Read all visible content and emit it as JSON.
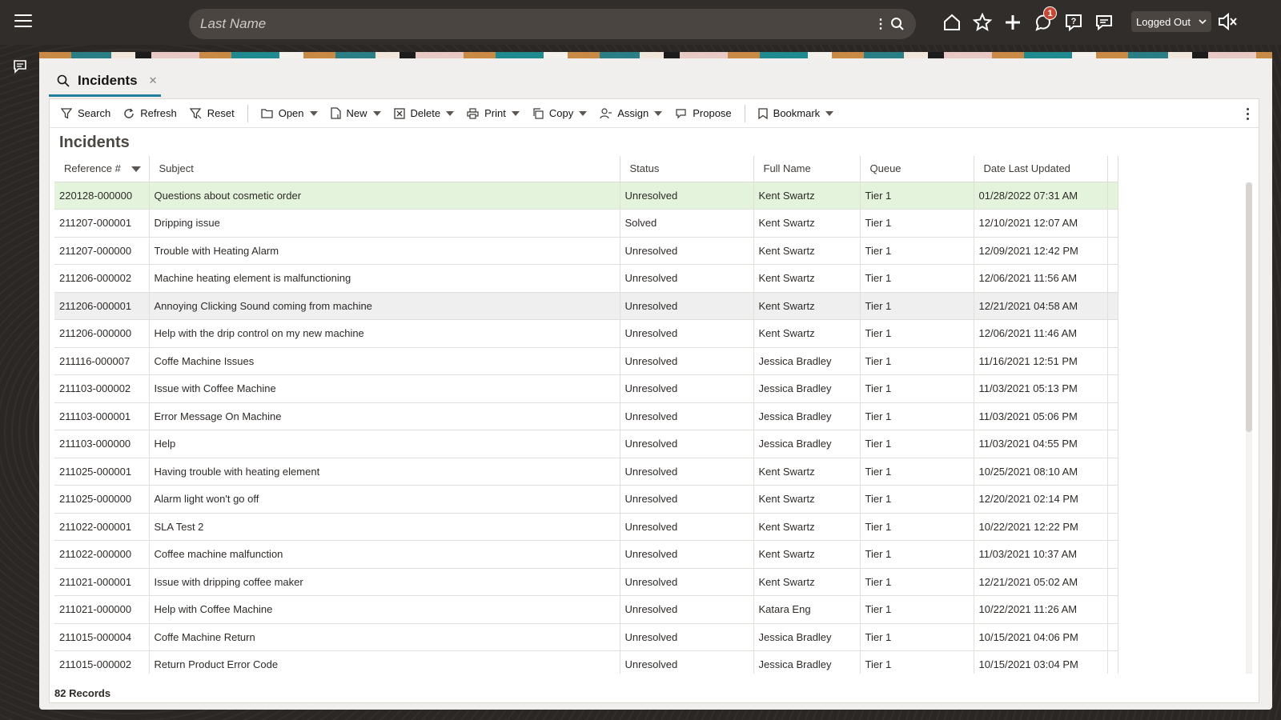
{
  "search": {
    "placeholder": "Last Name"
  },
  "notifications": {
    "count": "1"
  },
  "status": {
    "value": "Logged Out"
  },
  "tab": {
    "label": "Incidents"
  },
  "toolbar": {
    "search": "Search",
    "refresh": "Refresh",
    "reset": "Reset",
    "open": "Open",
    "new": "New",
    "delete": "Delete",
    "print": "Print",
    "copy": "Copy",
    "assign": "Assign",
    "propose": "Propose",
    "bookmark": "Bookmark"
  },
  "section_title": "Incidents",
  "columns": {
    "ref": "Reference #",
    "subject": "Subject",
    "status": "Status",
    "fullname": "Full Name",
    "queue": "Queue",
    "updated": "Date Last Updated"
  },
  "rows": [
    [
      "220128-000000",
      "Questions about cosmetic order",
      "Unresolved",
      "Kent Swartz",
      "Tier 1",
      "01/28/2022 07:31 AM"
    ],
    [
      "211207-000001",
      "Dripping issue",
      "Solved",
      "Kent Swartz",
      "Tier 1",
      "12/10/2021 12:07 AM"
    ],
    [
      "211207-000000",
      "Trouble with Heating Alarm",
      "Unresolved",
      "Kent Swartz",
      "Tier 1",
      "12/09/2021 12:42 PM"
    ],
    [
      "211206-000002",
      "Machine heating element is malfunctioning",
      "Unresolved",
      "Kent Swartz",
      "Tier 1",
      "12/06/2021 11:56 AM"
    ],
    [
      "211206-000001",
      "Annoying Clicking Sound coming from machine",
      "Unresolved",
      "Kent Swartz",
      "Tier 1",
      "12/21/2021 04:58 AM"
    ],
    [
      "211206-000000",
      "Help with the drip control on my new machine",
      "Unresolved",
      "Kent Swartz",
      "Tier 1",
      "12/06/2021 11:46 AM"
    ],
    [
      "211116-000007",
      "Coffe Machine Issues",
      "Unresolved",
      "Jessica Bradley",
      "Tier 1",
      "11/16/2021 12:51 PM"
    ],
    [
      "211103-000002",
      "Issue with Coffee Machine",
      "Unresolved",
      "Jessica Bradley",
      "Tier 1",
      "11/03/2021 05:13 PM"
    ],
    [
      "211103-000001",
      "Error Message On Machine",
      "Unresolved",
      "Jessica Bradley",
      "Tier 1",
      "11/03/2021 05:06 PM"
    ],
    [
      "211103-000000",
      "Help",
      "Unresolved",
      "Jessica Bradley",
      "Tier 1",
      "11/03/2021 04:55 PM"
    ],
    [
      "211025-000001",
      "Having trouble with heating element",
      "Unresolved",
      "Kent Swartz",
      "Tier 1",
      "10/25/2021 08:10 AM"
    ],
    [
      "211025-000000",
      "Alarm light won't go off",
      "Unresolved",
      "Kent Swartz",
      "Tier 1",
      "12/20/2021 02:14 PM"
    ],
    [
      "211022-000001",
      "SLA Test 2",
      "Unresolved",
      "Kent Swartz",
      "Tier 1",
      "10/22/2021 12:22 PM"
    ],
    [
      "211022-000000",
      "Coffee machine malfunction",
      "Unresolved",
      "Kent Swartz",
      "Tier 1",
      "11/03/2021 10:37 AM"
    ],
    [
      "211021-000001",
      "Issue with dripping coffee maker",
      "Unresolved",
      "Kent Swartz",
      "Tier 1",
      "12/21/2021 05:02 AM"
    ],
    [
      "211021-000000",
      "Help with Coffee Machine",
      "Unresolved",
      "Katara Eng",
      "Tier 1",
      "10/22/2021 11:26 AM"
    ],
    [
      "211015-000004",
      "Coffe Machine Return",
      "Unresolved",
      "Jessica Bradley",
      "Tier 1",
      "10/15/2021 04:06 PM"
    ],
    [
      "211015-000002",
      "Return Product Error Code",
      "Unresolved",
      "Jessica Bradley",
      "Tier 1",
      "10/15/2021 03:04 PM"
    ]
  ],
  "records": "82 Records",
  "colors": {
    "accent": "#227e9e",
    "selected_row": "#e3f3dc",
    "badge": "#c74634"
  }
}
